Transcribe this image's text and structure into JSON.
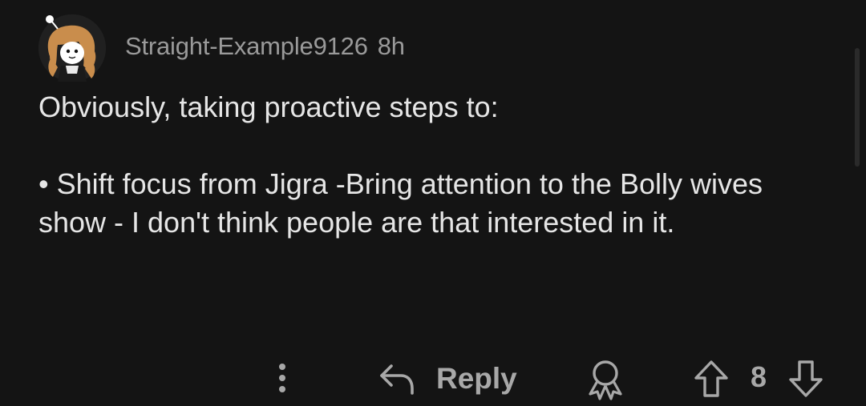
{
  "comment": {
    "username": "Straight-Example9126",
    "time": "8h",
    "body_line1": "Obviously, taking proactive steps to:",
    "body_bullet": "• Shift focus from Jigra -Bring attention to the Bolly wives show - I don't think people are that interested in it."
  },
  "actions": {
    "more_icon": "more-vertical-icon",
    "reply_label": "Reply",
    "reply_icon": "reply-arrow-icon",
    "award_icon": "award-icon",
    "upvote_icon": "upvote-arrow-icon",
    "score": "8",
    "downvote_icon": "downvote-arrow-icon"
  },
  "colors": {
    "background": "#141414",
    "text": "#e6e6e6",
    "muted": "#9a9a9a",
    "action": "#a8a8a8"
  }
}
